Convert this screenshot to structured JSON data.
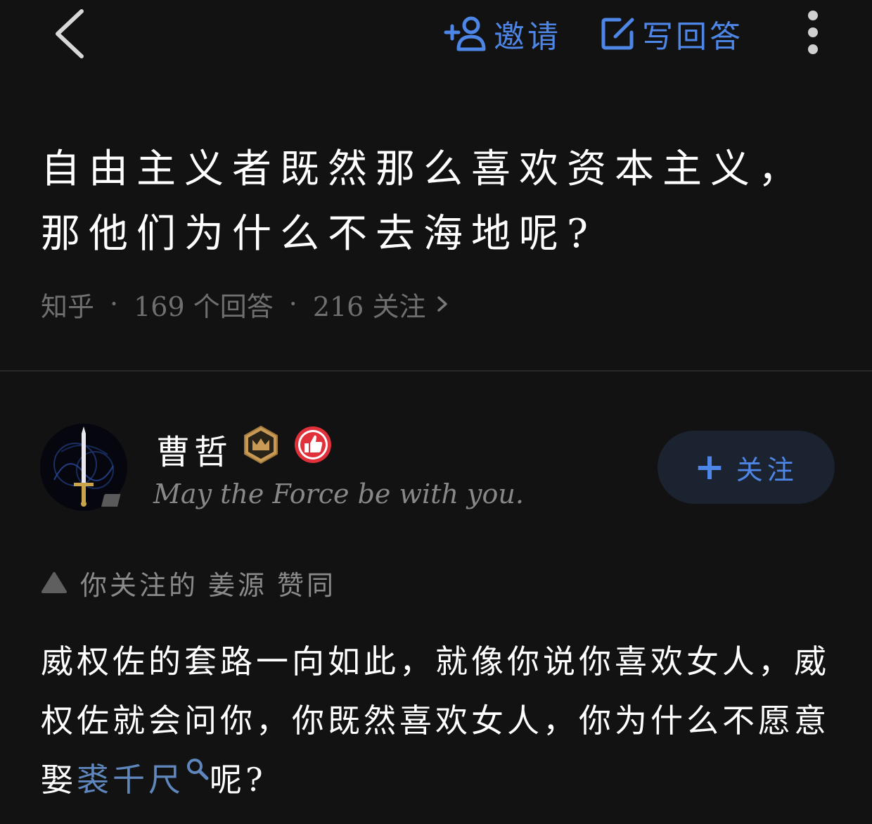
{
  "topbar": {
    "invite_label": "邀请",
    "write_answer_label": "写回答"
  },
  "question": {
    "title": "自由主义者既然那么喜欢资本主义，那他们为什么不去海地呢?",
    "source": "知乎",
    "answers_count": "169 个回答",
    "followers_count": "216 关注",
    "separator": "·"
  },
  "answer": {
    "author": {
      "name": "曹哲",
      "bio": "May the Force be with you."
    },
    "follow_button": {
      "label": "关注"
    },
    "social_proof": {
      "prefix": "你关注的",
      "person": "姜源",
      "action": "赞同"
    },
    "content": {
      "paragraph_1": "威权佐的套路一向如此，就像你说你喜欢女人，威权佐就会问你，你既然喜欢女人，你为什么不愿意娶",
      "keyword": "裘千尺",
      "suffix": "呢?"
    }
  },
  "colors": {
    "background": "#121212",
    "accent": "#4d86e6",
    "muted": "#6f6f6f",
    "keyword": "#5f87bd",
    "follow_button_bg": "#1b2230",
    "crown_badge": "#c89a55",
    "like_badge": "#e0303a"
  },
  "icons": {
    "back": "chevron-left-icon",
    "invite": "add-user-icon",
    "write": "edit-icon",
    "more": "more-vertical-icon",
    "meta_chevron": "chevron-right-icon",
    "crown": "crown-badge-icon",
    "like": "thumbs-up-badge-icon",
    "social": "triangle-up-icon",
    "search": "search-icon"
  }
}
